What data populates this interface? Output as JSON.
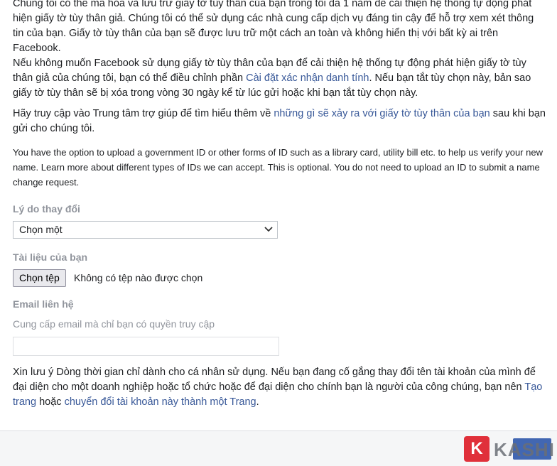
{
  "paragraphs": {
    "p1_line0": "Chúng tôi có thể mã hóa và lưu trữ giấy tờ tùy thân của bạn trong tối đa 1 năm để cải thiện hệ thống tự động",
    "p1_rest": "phát hiện giấy tờ tùy thân giả. Chúng tôi có thể sử dụng các nhà cung cấp dịch vụ đáng tin cậy để hỗ trợ xem xét thông tin của bạn. Giấy tờ tùy thân của bạn sẽ được lưu trữ một cách an toàn và không hiển thị với bất kỳ ai trên Facebook.",
    "p2_a": "Nếu không muốn Facebook sử dụng giấy tờ tùy thân của bạn để cải thiện hệ thống tự động phát hiện giấy tờ tùy thân giả của chúng tôi, bạn có thể điều chỉnh phần ",
    "p2_link": "Cài đặt xác nhận danh tính",
    "p2_b": ". Nếu bạn tắt tùy chọn này, bản sao giấy tờ tùy thân sẽ bị xóa trong vòng 30 ngày kể từ lúc gửi hoặc khi bạn tắt tùy chọn này.",
    "p3_a": "Hãy truy cập vào Trung tâm trợ giúp để tìm hiểu thêm về ",
    "p3_link": "những gì sẽ xảy ra với giấy tờ tùy thân của bạn",
    "p3_b": " sau khi bạn gửi cho chúng tôi.",
    "p4": "You have the option to upload a government ID or other forms of ID such as a library card, utility bill etc. to help us verify your new name. Learn more about different types of IDs we can accept. This is optional. You do not need to upload an ID to submit a name change request.",
    "p5_a": "Xin lưu ý Dòng thời gian chỉ dành cho cá nhân sử dụng. Nếu bạn đang cố gắng thay đổi tên tài khoản của mình để đại diện cho một doanh nghiệp hoặc tổ chức hoặc để đại diện cho chính bạn là người của công chúng, bạn nên ",
    "p5_link1": "Tạo trang",
    "p5_mid": " hoặc ",
    "p5_link2": "chuyển đổi tài khoản này thành một Trang",
    "p5_b": "."
  },
  "form": {
    "reason_label": "Lý do thay đổi",
    "reason_selected": "Chọn một",
    "documents_label": "Tài liệu của bạn",
    "file_button": "Chọn tệp",
    "file_status": "Không có tệp nào được chọn",
    "email_label": "Email liên hệ",
    "email_hint": "Cung cấp email mà chỉ bạn có quyền truy cập",
    "email_value": ""
  },
  "watermark": {
    "badge": "K",
    "text": "KASHI"
  },
  "colors": {
    "link": "#385898",
    "label": "#90949c",
    "primary_button": "#4267b2",
    "brand_red": "#e0303a"
  }
}
